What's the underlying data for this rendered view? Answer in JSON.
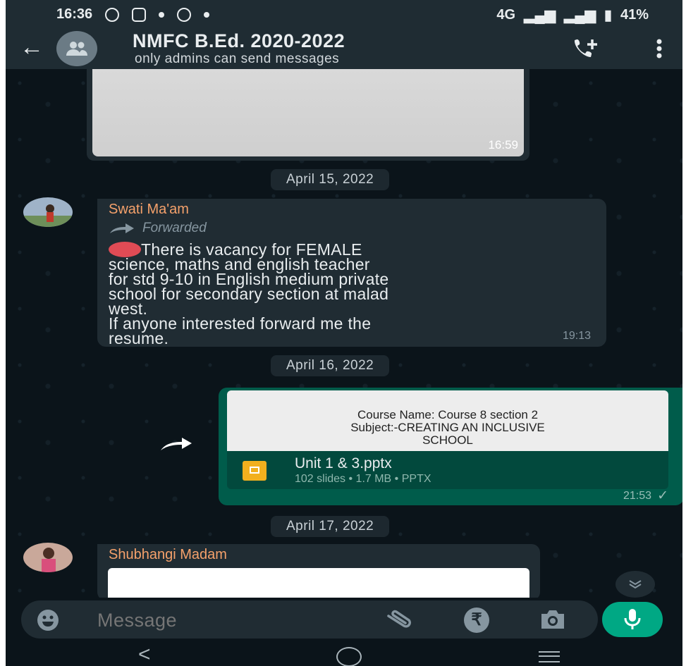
{
  "status_bar": {
    "time": "16:36",
    "network": "4G",
    "battery": "41%"
  },
  "header": {
    "title": "NMFC B.Ed. 2020-2022",
    "subtitle": "only admins can send messages",
    "icons": [
      "back-arrow-icon",
      "group-avatar-icon",
      "add-call-icon",
      "more-vert-icon"
    ]
  },
  "messages": [
    {
      "type": "image",
      "time": "16:59"
    },
    {
      "type": "date",
      "label": "April 15, 2022"
    },
    {
      "type": "incoming",
      "sender": "Swati Ma'am",
      "forwarded_label": "Forwarded",
      "lines": [
        "There is vacancy for FEMALE",
        "science, maths and english teacher",
        "for std 9-10 in English medium private",
        "school for secondary section at malad",
        "west.",
        "If anyone interested forward me the",
        "resume."
      ],
      "time": "19:13"
    },
    {
      "type": "date",
      "label": "April 16, 2022"
    },
    {
      "type": "outgoing_document",
      "preview_lines": [
        "Course  Name: Course  8 section  2",
        "Subject:-CREATING  AN INCLUSIVE",
        "SCHOOL"
      ],
      "file_name": "Unit 1 & 3.pptx",
      "file_meta": "102 slides • 1.7 MB • PPTX",
      "time": "21:53",
      "status": "✓"
    },
    {
      "type": "date",
      "label": "April 17, 2022"
    },
    {
      "type": "incoming_image",
      "sender": "Shubhangi Madam"
    }
  ],
  "composer": {
    "placeholder": "Message",
    "rupee_symbol": "₹"
  },
  "nav": {
    "back": "<"
  },
  "colors": {
    "background": "#0b141a",
    "header": "#1f2c33",
    "incoming_bubble": "#202c33",
    "outgoing_bubble": "#005c4b",
    "accent": "#00a884",
    "sender_name": "#f5a16b"
  }
}
